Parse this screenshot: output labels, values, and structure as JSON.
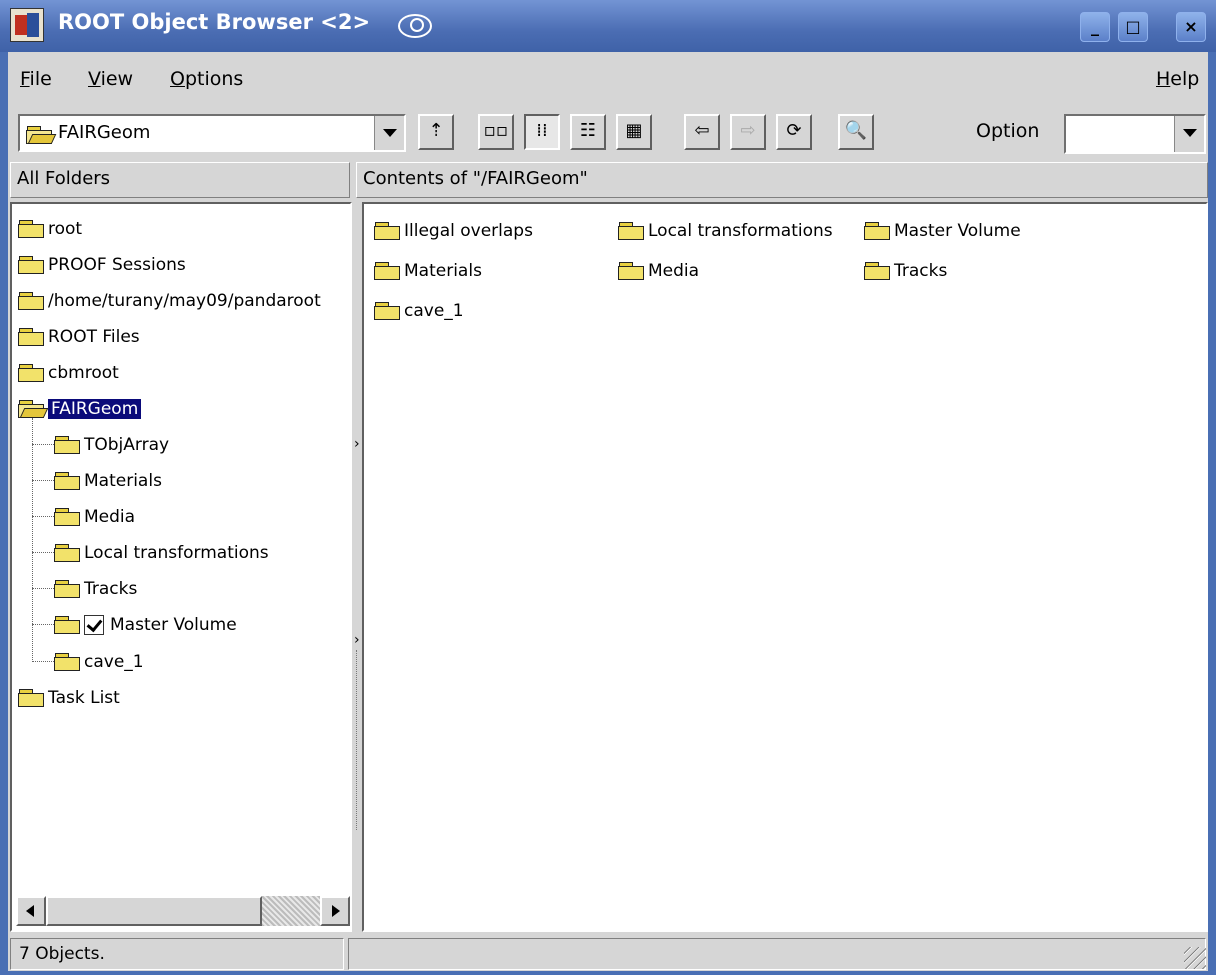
{
  "window": {
    "title": "ROOT Object Browser <2>",
    "buttons": {
      "minimize": "_",
      "maximize": "□",
      "close": "×"
    }
  },
  "menubar": {
    "file": {
      "accel": "F",
      "rest": "ile"
    },
    "view": {
      "accel": "V",
      "rest": "iew"
    },
    "options": {
      "accel": "O",
      "rest": "ptions"
    },
    "help": {
      "accel": "H",
      "rest": "elp"
    }
  },
  "toolbar": {
    "location": "FAIRGeom",
    "option_label": "Option",
    "option_value": "",
    "icons": [
      "folder-up-icon",
      "large-icons-view-icon",
      "small-icons-view-icon",
      "list-view-icon",
      "details-view-icon",
      "back-icon",
      "forward-icon",
      "refresh-icon",
      "execute-icon"
    ]
  },
  "left_panel": {
    "header": "All Folders",
    "tree": [
      {
        "label": "root",
        "level": 0
      },
      {
        "label": "PROOF Sessions",
        "level": 0
      },
      {
        "label": "/home/turany/may09/pandaroot",
        "level": 0
      },
      {
        "label": "ROOT Files",
        "level": 0
      },
      {
        "label": "cbmroot",
        "level": 0
      },
      {
        "label": "FAIRGeom",
        "level": 0,
        "open": true,
        "selected": true
      },
      {
        "label": "TObjArray",
        "level": 1
      },
      {
        "label": "Materials",
        "level": 1
      },
      {
        "label": "Media",
        "level": 1
      },
      {
        "label": "Local transformations",
        "level": 1
      },
      {
        "label": "Tracks",
        "level": 1
      },
      {
        "label": "Master Volume",
        "level": 1,
        "checkbox": true
      },
      {
        "label": "cave_1",
        "level": 1
      },
      {
        "label": "Task List",
        "level": 0
      }
    ]
  },
  "right_panel": {
    "header": "Contents of \"/FAIRGeom\"",
    "items": [
      "Illegal overlaps",
      "Local transformations",
      "Master Volume",
      "Materials",
      "Media",
      "Tracks",
      "cave_1"
    ]
  },
  "status": {
    "left": "7 Objects.",
    "right": ""
  },
  "colors": {
    "titlebar": "#4b6db3",
    "selection": "#0a0a7a",
    "folder": "#f2e26a",
    "chrome": "#d6d6d6"
  }
}
